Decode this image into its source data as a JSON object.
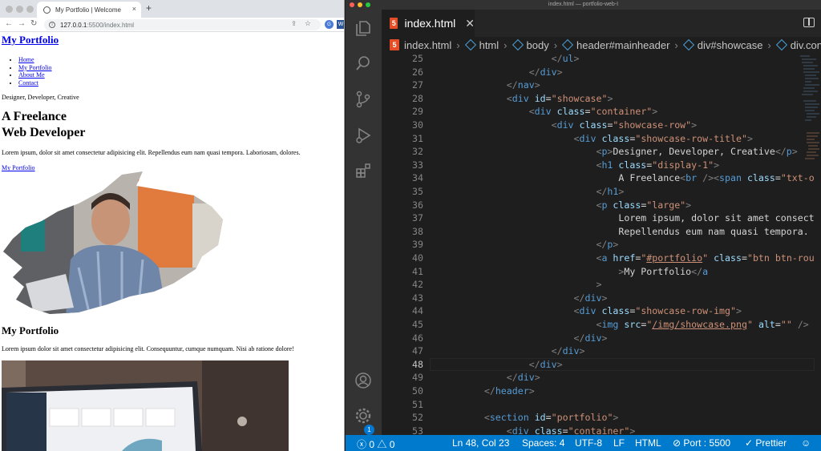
{
  "browser": {
    "tab_title": "My Portfolio | Welcome",
    "tab_close": "×",
    "new_tab": "+",
    "url_host": "127.0.0.1",
    "url_rest": ":5500/index.html",
    "page": {
      "logo": "My Portfolio",
      "nav": [
        "Home",
        "My Portfolio",
        "About Me",
        "Contact"
      ],
      "tagline": "Designer, Developer, Creative",
      "headline_line1": "A Freelance",
      "headline_line2": "Web Developer",
      "lorem": "Lorem ipsum, dolor sit amet consectetur adipisicing elit. Repellendus eum nam quasi tempora. Laboriosam, dolores.",
      "portfolio_link": "My Portfolio",
      "section_title": "My Portfolio",
      "section_lorem": "Lorem ipsum dolor sit amet consectetur adipisicing elit. Consequuntur, cumque numquam. Nisi ab ratione dolore!"
    }
  },
  "vscode": {
    "window_title": "index.html — portfolio-web-I",
    "tab_label": "index.html",
    "breadcrumbs": [
      "index.html",
      "html",
      "body",
      "header#mainheader",
      "div#showcase",
      "div.conta"
    ],
    "line_numbers": [
      "25",
      "26",
      "27",
      "28",
      "29",
      "30",
      "31",
      "32",
      "33",
      "34",
      "35",
      "36",
      "37",
      "38",
      "39",
      "40",
      "41",
      "42",
      "43",
      "44",
      "45",
      "46",
      "47",
      "48",
      "49",
      "50",
      "51",
      "52",
      "53"
    ],
    "current_line": "48",
    "status": {
      "errors": "0",
      "warnings": "0",
      "position": "Ln 48, Col 23",
      "spaces": "Spaces: 4",
      "encoding": "UTF-8",
      "eol": "LF",
      "language": "HTML",
      "port": "Port : 5500",
      "prettier": "Prettier"
    },
    "extensions_badge": "1"
  },
  "colors": {
    "vscode_bg": "#1e1e1e",
    "status_bar": "#007acc",
    "tag": "#569cd6",
    "attribute": "#9cdcfe",
    "string": "#ce9178",
    "link": "#0000ee"
  }
}
